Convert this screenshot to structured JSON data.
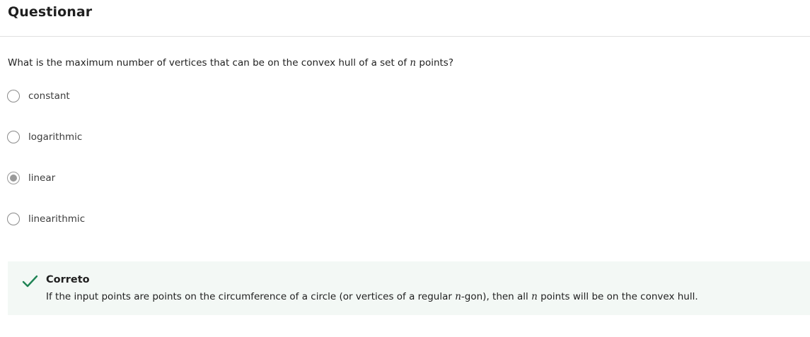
{
  "header": {
    "title": "Questionar"
  },
  "question": {
    "text_before": "What is the maximum number of vertices that can be on the convex hull of a set of ",
    "variable": "n",
    "text_after": " points?"
  },
  "options": [
    {
      "label": "constant",
      "selected": false
    },
    {
      "label": "logarithmic",
      "selected": false
    },
    {
      "label": "linear",
      "selected": true
    },
    {
      "label": "linearithmic",
      "selected": false
    }
  ],
  "feedback": {
    "status": "Correto",
    "icon": "check-icon",
    "accent_color": "#1f8354",
    "background_color": "#f3f8f5",
    "text_part1": "If the input points are points on the circumference of a circle (or vertices of a regular ",
    "var1": "n",
    "text_part2": "-gon), then all ",
    "var2": "n",
    "text_part3": " points will be on the convex hull."
  }
}
